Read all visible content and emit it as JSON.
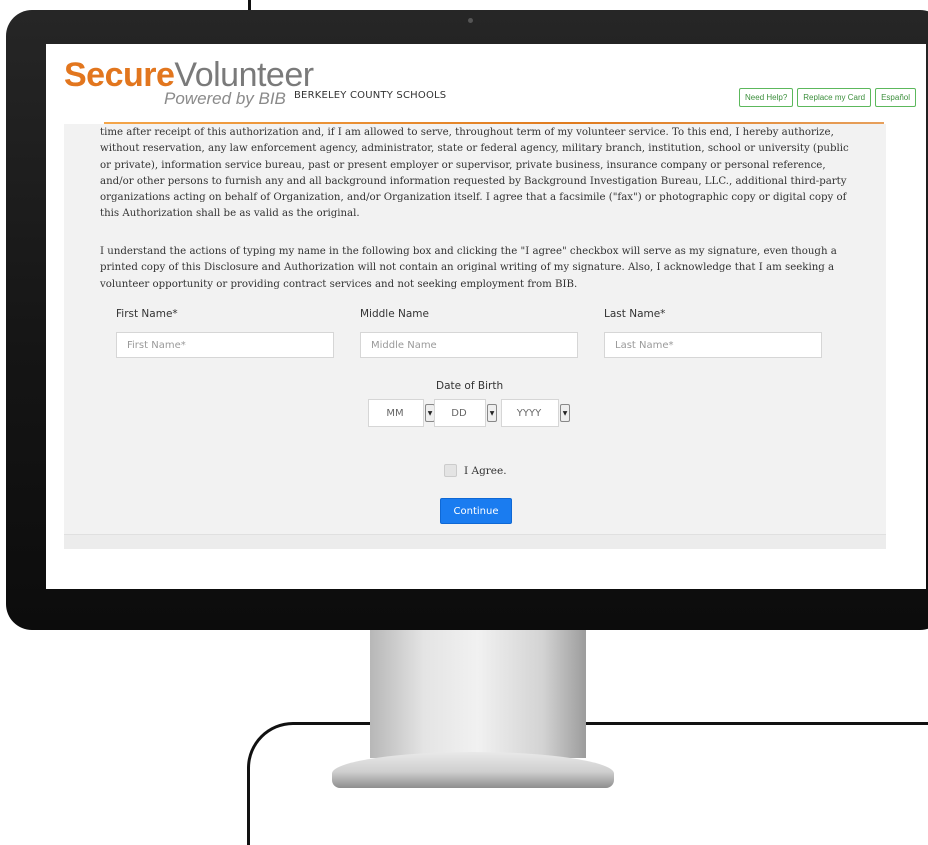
{
  "header": {
    "logo_bold": "Secure",
    "logo_light": "Volunteer",
    "logo_tagline": "Powered by BIB",
    "organization": "BERKELEY COUNTY SCHOOLS",
    "buttons": [
      "Need Help?",
      "Replace my Card",
      "Español"
    ]
  },
  "body": {
    "paragraph1": "time after receipt of this authorization and, if I am allowed to serve, throughout term of my volunteer service. To this end, I hereby authorize, without reservation, any law enforcement agency, administrator, state or federal agency, military branch, institution, school or university (public or private), information service bureau, past or present employer or supervisor, private business, insurance company or personal reference, and/or other persons to furnish any and all background information requested by Background Investigation Bureau, LLC., additional third-party organizations acting on behalf of Organization, and/or Organization itself. I agree that a facsimile (\"fax\") or photographic copy or digital copy of this Authorization shall be as valid as the original.",
    "paragraph2": "I understand the actions of typing my name in the following box and clicking the \"I agree\" checkbox will serve as my signature, even though a printed copy of this Disclosure and Authorization will not contain an original writing of my signature. Also, I acknowledge that I am seeking a volunteer opportunity or providing contract services and not seeking employment from BIB."
  },
  "form": {
    "first_name": {
      "label": "First Name*",
      "placeholder": "First Name*",
      "value": ""
    },
    "middle_name": {
      "label": "Middle Name",
      "placeholder": "Middle Name",
      "value": ""
    },
    "last_name": {
      "label": "Last Name*",
      "placeholder": "Last Name*",
      "value": ""
    },
    "dob": {
      "label": "Date of Birth",
      "month": "MM",
      "day": "DD",
      "year": "YYYY"
    },
    "agree_label": "I Agree.",
    "agree_checked": false,
    "continue_label": "Continue"
  },
  "colors": {
    "brand_orange": "#e2761e",
    "help_green": "#5cb85c",
    "continue_blue": "#1a7cf0"
  }
}
